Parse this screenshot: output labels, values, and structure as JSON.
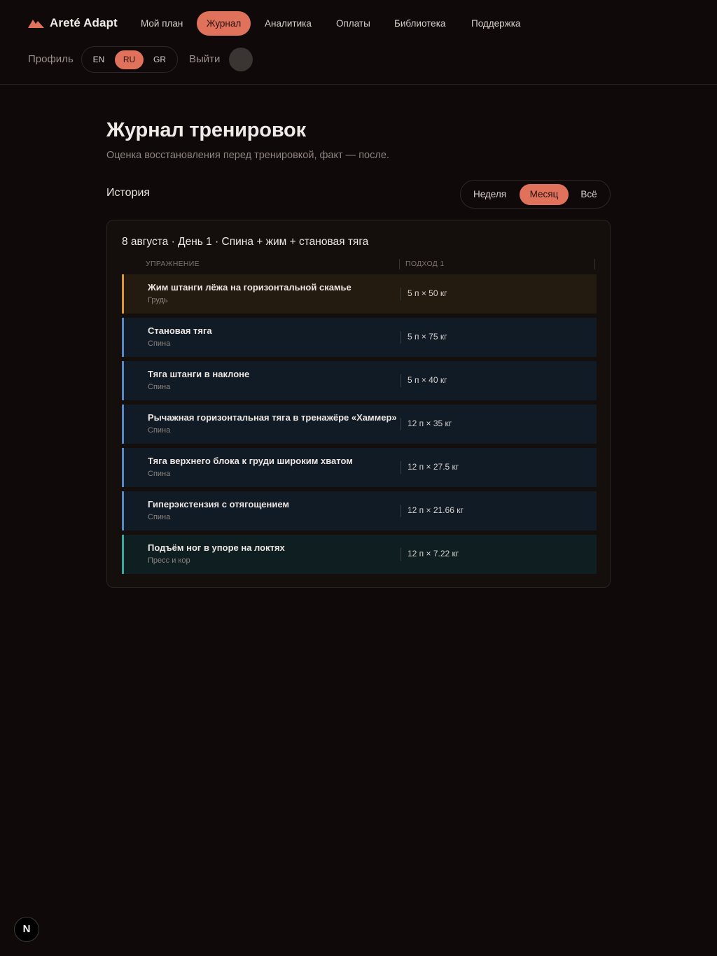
{
  "brand": {
    "name": "Areté Adapt",
    "logo_icon": "mountain-icon",
    "accent": "#e0725c"
  },
  "nav": {
    "items": [
      {
        "label": "Мой план",
        "active": false
      },
      {
        "label": "Журнал",
        "active": true
      },
      {
        "label": "Аналитика",
        "active": false
      },
      {
        "label": "Оплаты",
        "active": false
      },
      {
        "label": "Библиотека",
        "active": false
      },
      {
        "label": "Поддержка",
        "active": false
      }
    ]
  },
  "account": {
    "profile_label": "Профиль",
    "languages": [
      {
        "label": "EN",
        "active": false
      },
      {
        "label": "RU",
        "active": true
      },
      {
        "label": "GR",
        "active": false
      }
    ],
    "logout_label": "Выйти"
  },
  "page": {
    "title": "Журнал тренировок",
    "subtitle": "Оценка восстановления перед тренировкой, факт — после."
  },
  "history": {
    "label": "История",
    "ranges": [
      {
        "label": "Неделя",
        "active": false
      },
      {
        "label": "Месяц",
        "active": true
      },
      {
        "label": "Всё",
        "active": false
      }
    ]
  },
  "workout": {
    "title": "8 августа · День 1 · Спина + жим + становая тяга",
    "columns": {
      "exercise": "УПРАЖНЕНИЕ",
      "set1": "ПОДХОД 1"
    },
    "exercises": [
      {
        "name": "Жим штанги лёжа на горизонтальной скамье",
        "muscle": "Грудь",
        "set1": "5 п × 50 кг",
        "accent": "#d9963a",
        "bg": "#241b10"
      },
      {
        "name": "Становая тяга",
        "muscle": "Спина",
        "set1": "5 п × 75 кг",
        "accent": "#5a86c2",
        "bg": "#111b25"
      },
      {
        "name": "Тяга штанги в наклоне",
        "muscle": "Спина",
        "set1": "5 п × 40 кг",
        "accent": "#5a86c2",
        "bg": "#111b25"
      },
      {
        "name": "Рычажная горизонтальная тяга в тренажёре «Хаммер»",
        "muscle": "Спина",
        "set1": "12 п × 35 кг",
        "accent": "#5a86c2",
        "bg": "#111b25"
      },
      {
        "name": "Тяга верхнего блока к груди широким хватом",
        "muscle": "Спина",
        "set1": "12 п × 27.5 кг",
        "accent": "#5a86c2",
        "bg": "#111b25"
      },
      {
        "name": "Гиперэкстензия с отягощением",
        "muscle": "Спина",
        "set1": "12 п × 21.66 кг",
        "accent": "#5a86c2",
        "bg": "#111b25"
      },
      {
        "name": "Подъём ног в упоре на локтях",
        "muscle": "Пресс и кор",
        "set1": "12 п × 7.22 кг",
        "accent": "#3aa89a",
        "bg": "#0f1f21"
      }
    ]
  },
  "devtools": {
    "label": "N"
  }
}
